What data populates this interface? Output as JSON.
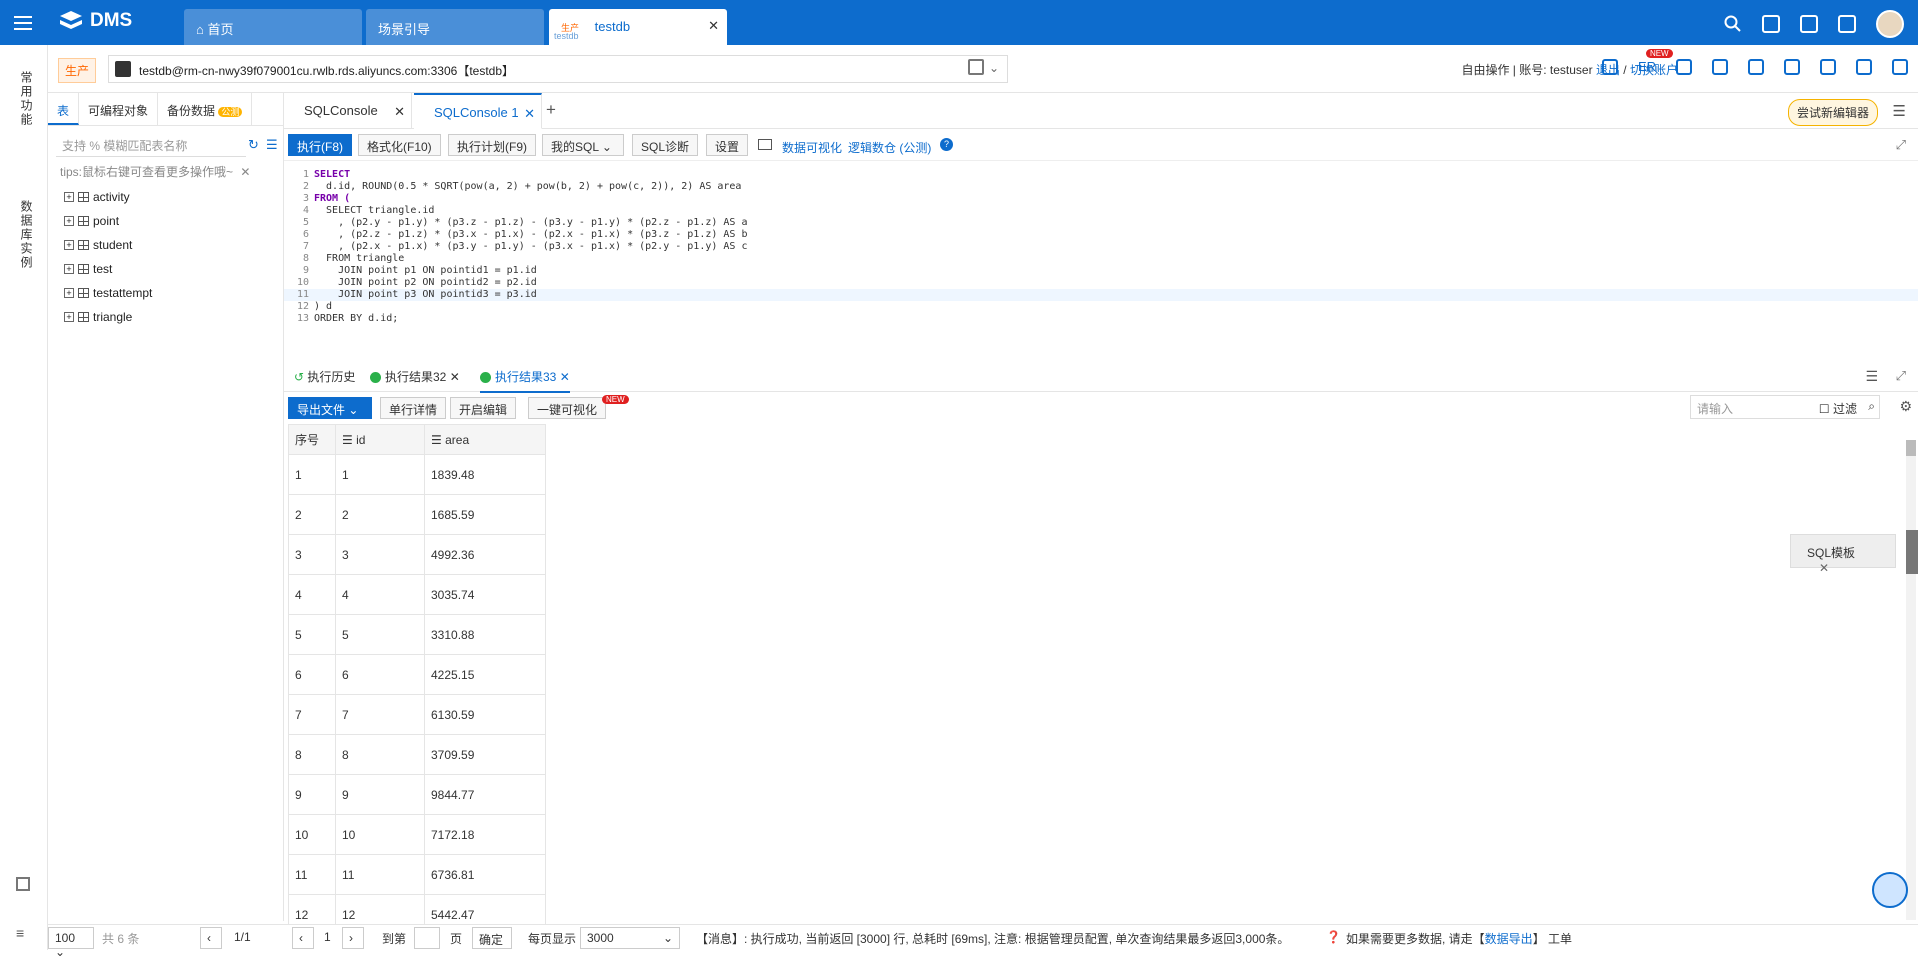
{
  "app": {
    "name": "DMS"
  },
  "top_tabs": [
    {
      "label": "首页"
    },
    {
      "label": "场景引导"
    },
    {
      "env": "生产",
      "label": "testdb",
      "sub": "testdb"
    }
  ],
  "left_rail": {
    "item1": "常用功能",
    "item2": "数据库实例"
  },
  "connection": {
    "env": "生产",
    "value": "testdb@rm-cn-nwy39f079001cu.rwlb.rds.aliyuncs.com:3306【testdb】",
    "mode": "自由操作 | 账号: testuser",
    "logout": "退出",
    "sep": "/",
    "switch": "切换账户",
    "er": "ER",
    "new": "NEW"
  },
  "object_panel": {
    "tabs": [
      "表",
      "可编程对象",
      "备份数据"
    ],
    "beta": "公测",
    "search_placeholder": "支持 % 模糊匹配表名称",
    "tips": "tips:鼠标右键可查看更多操作哦~",
    "tables": [
      "activity",
      "point",
      "student",
      "test",
      "testattempt",
      "triangle"
    ]
  },
  "editor_tabs": [
    {
      "label": "SQLConsole"
    },
    {
      "label": "SQLConsole 1"
    }
  ],
  "try_new": "尝试新编辑器",
  "toolbar": {
    "execute": "执行(F8)",
    "format": "格式化(F10)",
    "plan": "执行计划(F9)",
    "my_sql": "我的SQL",
    "diagnose": "SQL诊断",
    "settings": "设置",
    "visualize": "数据可视化",
    "logic": "逻辑数仓 (公测)"
  },
  "code_lines": [
    "SELECT",
    "  d.id, ROUND(0.5 * SQRT(pow(a, 2) + pow(b, 2) + pow(c, 2)), 2) AS area",
    "FROM (",
    "  SELECT triangle.id",
    "    , (p2.y - p1.y) * (p3.z - p1.z) - (p3.y - p1.y) * (p2.z - p1.z) AS a",
    "    , (p2.z - p1.z) * (p3.x - p1.x) - (p2.x - p1.x) * (p3.z - p1.z) AS b",
    "    , (p2.x - p1.x) * (p3.y - p1.y) - (p3.x - p1.x) * (p2.y - p1.y) AS c",
    "  FROM triangle",
    "    JOIN point p1 ON pointid1 = p1.id",
    "    JOIN point p2 ON pointid2 = p2.id",
    "    JOIN point p3 ON pointid3 = p3.id",
    ") d",
    "ORDER BY d.id;"
  ],
  "result_tabs": [
    {
      "label": "执行历史"
    },
    {
      "label": "执行结果32"
    },
    {
      "label": "执行结果33"
    }
  ],
  "result_toolbar": {
    "export": "导出文件",
    "row_detail": "单行详情",
    "enable_edit": "开启编辑",
    "one_click": "一键可视化",
    "new": "NEW",
    "search_placeholder": "请输入",
    "filter": "过滤"
  },
  "result_table": {
    "headers": [
      "序号",
      "id",
      "area"
    ],
    "rows": [
      [
        "1",
        "1",
        "1839.48"
      ],
      [
        "2",
        "2",
        "1685.59"
      ],
      [
        "3",
        "3",
        "4992.36"
      ],
      [
        "4",
        "4",
        "3035.74"
      ],
      [
        "5",
        "5",
        "3310.88"
      ],
      [
        "6",
        "6",
        "4225.15"
      ],
      [
        "7",
        "7",
        "6130.59"
      ],
      [
        "8",
        "8",
        "3709.59"
      ],
      [
        "9",
        "9",
        "9844.77"
      ],
      [
        "10",
        "10",
        "7172.18"
      ],
      [
        "11",
        "11",
        "6736.81"
      ],
      [
        "12",
        "12",
        "5442.47"
      ]
    ]
  },
  "sql_template": "SQL模板",
  "status": {
    "page_size_left": "100",
    "total": "共 6 条",
    "pager_left": "1/1",
    "page": "1",
    "goto": "到第",
    "page_unit": "页",
    "confirm": "确定",
    "per_page": "每页显示",
    "per_page_value": "3000",
    "message": "【消息】: 执行成功, 当前返回 [3000] 行, 总耗时 [69ms], 注意: 根据管理员配置, 单次查询结果最多返回3,000条。",
    "more": "如果需要更多数据, 请走【",
    "export_link": "数据导出",
    "more_end": "】 工单"
  }
}
